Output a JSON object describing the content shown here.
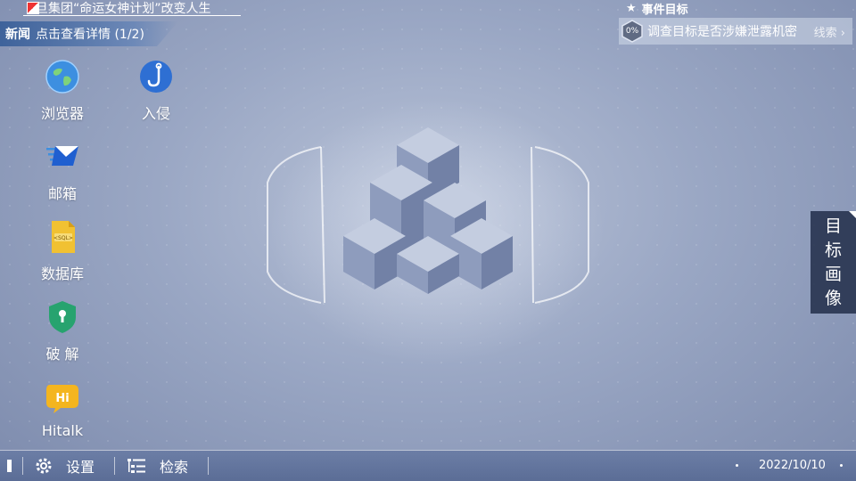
{
  "ticker": {
    "text": "旦集团“命运女神计划”改变人生"
  },
  "news": {
    "tag": "新闻",
    "text": "点击查看详情 (1/2)"
  },
  "event": {
    "title": "事件目标",
    "progress": "0%",
    "description": "调查目标是否涉嫌泄露机密",
    "clue_label": "线索"
  },
  "apps": [
    {
      "label": "浏览器",
      "icon": "globe-icon"
    },
    {
      "label": "入侵",
      "icon": "hook-icon"
    },
    {
      "label": "邮箱",
      "icon": "mail-icon"
    },
    {
      "label": "数据库",
      "icon": "sql-file-icon"
    },
    {
      "label": "破 解",
      "icon": "shield-key-icon"
    },
    {
      "label": "Hitalk",
      "icon": "chat-bubble-icon"
    }
  ],
  "apps_icon_text": {
    "sql": "<SQL>",
    "hi": "Hi"
  },
  "profile_tab": {
    "chars": [
      "目",
      "标",
      "画",
      "像"
    ]
  },
  "taskbar": {
    "settings_label": "设置",
    "search_label": "检索",
    "date": "2022/10/10"
  },
  "colors": {
    "accent_blue": "#2f6fd6",
    "panel_dark": "#28344f",
    "taskbar": "#5b6d96"
  }
}
